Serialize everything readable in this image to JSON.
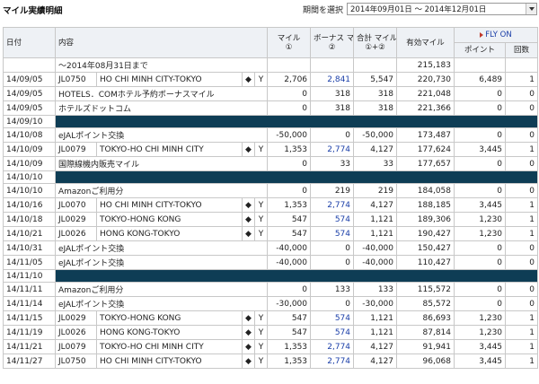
{
  "page_title": "マイル実績明細",
  "period": {
    "label": "期間を選択",
    "value": "2014年09月01日 〜 2014年12月01日"
  },
  "headers": {
    "date": "日付",
    "content": "内容",
    "mile": "マイル",
    "mile_sub": "①",
    "bonus": "ボーナス マイル",
    "bonus_sub": "②",
    "total": "合計 マイル",
    "total_sub": "①+②",
    "valid": "有効マイル",
    "flyon": "FLY ON",
    "points": "ポイント",
    "count": "回数"
  },
  "rows": [
    {
      "type": "row",
      "date": "",
      "flight": "",
      "content": "〜2014年08月31日まで",
      "diamond": "",
      "class": "",
      "mile": "",
      "bonus": "",
      "total": "",
      "valid": "215,183",
      "points": "",
      "count": ""
    },
    {
      "type": "row",
      "date": "14/09/05",
      "flight": "JL0750",
      "content": "HO CHI MINH CITY-TOKYO",
      "diamond": "◆",
      "class": "Y",
      "mile": "2,706",
      "bonus": "2,841",
      "total": "5,547",
      "valid": "220,730",
      "points": "6,489",
      "count": "1"
    },
    {
      "type": "row",
      "date": "14/09/05",
      "flight": "",
      "content": "HOTELS．COMホテル予約ボーナスマイル",
      "diamond": "",
      "class": "",
      "mile": "0",
      "bonus": "318",
      "total": "318",
      "valid": "221,048",
      "points": "0",
      "count": "0"
    },
    {
      "type": "row",
      "date": "14/09/05",
      "flight": "",
      "content": "ホテルズドットコム",
      "diamond": "",
      "class": "",
      "mile": "0",
      "bonus": "318",
      "total": "318",
      "valid": "221,366",
      "points": "0",
      "count": "0"
    },
    {
      "type": "sep",
      "date": "14/09/10"
    },
    {
      "type": "row",
      "date": "14/10/08",
      "flight": "",
      "content": "eJALポイント交換",
      "diamond": "",
      "class": "",
      "mile": "-50,000",
      "bonus": "0",
      "total": "-50,000",
      "valid": "173,487",
      "points": "0",
      "count": "0"
    },
    {
      "type": "row",
      "date": "14/10/09",
      "flight": "JL0079",
      "content": "TOKYO-HO CHI MINH CITY",
      "diamond": "◆",
      "class": "Y",
      "mile": "1,353",
      "bonus": "2,774",
      "total": "4,127",
      "valid": "177,624",
      "points": "3,445",
      "count": "1"
    },
    {
      "type": "row",
      "date": "14/10/09",
      "flight": "",
      "content": "国際線機内販売マイル",
      "diamond": "",
      "class": "",
      "mile": "0",
      "bonus": "33",
      "total": "33",
      "valid": "177,657",
      "points": "0",
      "count": "0"
    },
    {
      "type": "sep",
      "date": "14/10/10"
    },
    {
      "type": "row",
      "date": "14/10/10",
      "flight": "",
      "content": "Amazonご利用分",
      "diamond": "",
      "class": "",
      "mile": "0",
      "bonus": "219",
      "total": "219",
      "valid": "184,058",
      "points": "0",
      "count": "0"
    },
    {
      "type": "row",
      "date": "14/10/16",
      "flight": "JL0070",
      "content": "HO CHI MINH CITY-TOKYO",
      "diamond": "◆",
      "class": "Y",
      "mile": "1,353",
      "bonus": "2,774",
      "total": "4,127",
      "valid": "188,185",
      "points": "3,445",
      "count": "1"
    },
    {
      "type": "row",
      "date": "14/10/18",
      "flight": "JL0029",
      "content": "TOKYO-HONG KONG",
      "diamond": "◆",
      "class": "Y",
      "mile": "547",
      "bonus": "574",
      "total": "1,121",
      "valid": "189,306",
      "points": "1,230",
      "count": "1"
    },
    {
      "type": "row",
      "date": "14/10/21",
      "flight": "JL0026",
      "content": "HONG KONG-TOKYO",
      "diamond": "◆",
      "class": "Y",
      "mile": "547",
      "bonus": "574",
      "total": "1,121",
      "valid": "190,427",
      "points": "1,230",
      "count": "1"
    },
    {
      "type": "row",
      "date": "14/10/31",
      "flight": "",
      "content": "eJALポイント交換",
      "diamond": "",
      "class": "",
      "mile": "-40,000",
      "bonus": "0",
      "total": "-40,000",
      "valid": "150,427",
      "points": "0",
      "count": "0"
    },
    {
      "type": "row",
      "date": "14/11/05",
      "flight": "",
      "content": "eJALポイント交換",
      "diamond": "",
      "class": "",
      "mile": "-40,000",
      "bonus": "0",
      "total": "-40,000",
      "valid": "110,427",
      "points": "0",
      "count": "0"
    },
    {
      "type": "sep",
      "date": "14/11/10"
    },
    {
      "type": "row",
      "date": "14/11/11",
      "flight": "",
      "content": "Amazonご利用分",
      "diamond": "",
      "class": "",
      "mile": "0",
      "bonus": "133",
      "total": "133",
      "valid": "115,572",
      "points": "0",
      "count": "0"
    },
    {
      "type": "row",
      "date": "14/11/14",
      "flight": "",
      "content": "eJALポイント交換",
      "diamond": "",
      "class": "",
      "mile": "-30,000",
      "bonus": "0",
      "total": "-30,000",
      "valid": "85,572",
      "points": "0",
      "count": "0"
    },
    {
      "type": "row",
      "date": "14/11/15",
      "flight": "JL0029",
      "content": "TOKYO-HONG KONG",
      "diamond": "◆",
      "class": "Y",
      "mile": "547",
      "bonus": "574",
      "total": "1,121",
      "valid": "86,693",
      "points": "1,230",
      "count": "1"
    },
    {
      "type": "row",
      "date": "14/11/19",
      "flight": "JL0026",
      "content": "HONG KONG-TOKYO",
      "diamond": "◆",
      "class": "Y",
      "mile": "547",
      "bonus": "574",
      "total": "1,121",
      "valid": "87,814",
      "points": "1,230",
      "count": "1"
    },
    {
      "type": "row",
      "date": "14/11/21",
      "flight": "JL0079",
      "content": "TOKYO-HO CHI MINH CITY",
      "diamond": "◆",
      "class": "Y",
      "mile": "1,353",
      "bonus": "2,774",
      "total": "4,127",
      "valid": "91,941",
      "points": "3,445",
      "count": "1"
    },
    {
      "type": "row",
      "date": "14/11/27",
      "flight": "JL0750",
      "content": "HO CHI MINH CITY-TOKYO",
      "diamond": "◆",
      "class": "Y",
      "mile": "1,353",
      "bonus": "2,774",
      "total": "4,127",
      "valid": "96,068",
      "points": "3,445",
      "count": "1"
    }
  ]
}
